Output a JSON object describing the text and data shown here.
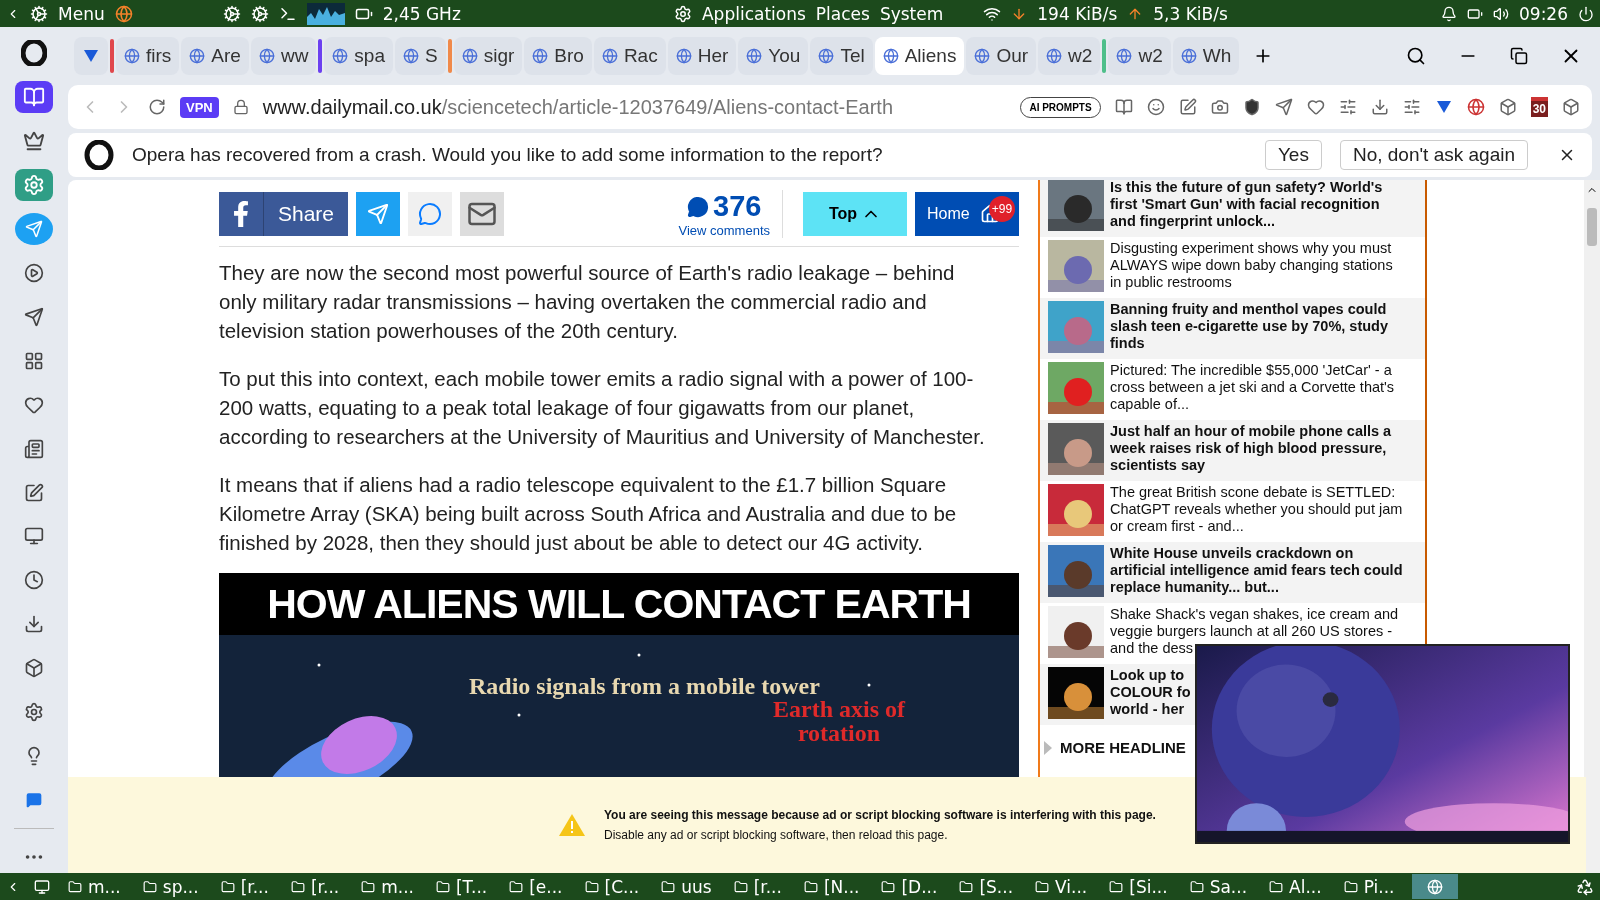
{
  "system_panel": {
    "menu": "Menu",
    "cpu": "2,45 GHz",
    "menus": [
      "Applications",
      "Places",
      "System"
    ],
    "download": "194 KiB/s",
    "upload": "5,3 KiB/s",
    "time": "09:26"
  },
  "tabs": [
    {
      "label": "firs",
      "selected": false,
      "color": "#e0474c"
    },
    {
      "label": "Are",
      "selected": false
    },
    {
      "label": "ww",
      "selected": false
    },
    {
      "label": "spa",
      "selected": false,
      "color": "#6b3ff0"
    },
    {
      "label": "S",
      "selected": false
    },
    {
      "label": "sigr",
      "selected": false,
      "color": "#f0894a"
    },
    {
      "label": "Bro",
      "selected": false
    },
    {
      "label": "Rac",
      "selected": false
    },
    {
      "label": "Her",
      "selected": false
    },
    {
      "label": "You",
      "selected": false
    },
    {
      "label": "Tel",
      "selected": false
    },
    {
      "label": "Aliens",
      "selected": true
    },
    {
      "label": "Our",
      "selected": false
    },
    {
      "label": "w2",
      "selected": false
    },
    {
      "label": "w2",
      "selected": false,
      "color": "#4fbf8a"
    },
    {
      "label": "Wh",
      "selected": false
    }
  ],
  "address_bar": {
    "vpn": "VPN",
    "host": "www.dailymail.co.uk",
    "path": "/sciencetech/article-12037649/Aliens-contact-Earth",
    "ai_prompts": "AI PROMPTS",
    "calendar_day": "30"
  },
  "crash_bar": {
    "message": "Opera has recovered from a crash. Would you like to add some information to the report?",
    "buttons": [
      "Yes",
      "No, don't ask again"
    ]
  },
  "share": {
    "share_label": "Share",
    "comment_count": "376",
    "comments_link": "View comments",
    "top": "Top",
    "home": "Home",
    "home_badge": "+99"
  },
  "paragraphs": [
    "They are now the second most powerful source of Earth's radio leakage – behind only military radar transmissions – having overtaken the commercial radio and television station powerhouses of the 20th century.",
    "To put this into context, each mobile tower emits a radio signal with a power of 100-200 watts, equating to a peak total leakage of four gigawatts from our planet, according to researchers at the University of Mauritius and University of Manchester.",
    "It means that if aliens had a radio telescope equivalent to the £1.7 billion Square Kilometre Array (SKA) being built across South Africa and Australia and due to be finished by 2028, then they should just about be able to detect our 4G activity."
  ],
  "infographic": {
    "title": "HOW ALIENS WILL CONTACT EARTH",
    "labels": [
      "Radio signals from a mobile tower",
      "Earth axis of rotation"
    ]
  },
  "headlines": [
    {
      "lines": [
        "Is this the future of gun safety? World's",
        "first 'Smart Gun' with facial recognition",
        "and fingerprint unlock..."
      ],
      "bold": true
    },
    {
      "lines": [
        "Disgusting experiment shows why you must",
        "ALWAYS wipe down baby changing stations",
        "in public restrooms"
      ],
      "bold": false
    },
    {
      "lines": [
        "Banning fruity and menthol vapes could",
        "slash teen e-cigarette use by 70%, study",
        "finds"
      ],
      "bold": true
    },
    {
      "lines": [
        "Pictured: The incredible $55,000 'JetCar' - a",
        "cross between a jet ski and a Corvette that's",
        "capable of..."
      ],
      "bold": false
    },
    {
      "lines": [
        "Just half an hour of mobile phone calls a",
        "week raises risk of high blood pressure,",
        "scientists say"
      ],
      "bold": true
    },
    {
      "lines": [
        "The great British scone debate is SETTLED:",
        "ChatGPT reveals whether you should put jam",
        "or cream first - and..."
      ],
      "bold": false
    },
    {
      "lines": [
        "White House unveils crackdown on",
        "artificial intelligence amid fears tech could",
        "replace humanity... but..."
      ],
      "bold": true
    },
    {
      "lines": [
        "Shake Shack's vegan shakes, ice cream and",
        "veggie burgers launch at all 260 US stores -",
        "and the dess"
      ],
      "bold": false
    },
    {
      "lines": [
        "Look up to",
        "COLOUR fo",
        "world - her"
      ],
      "bold": true
    }
  ],
  "more_headlines": "MORE HEADLINE",
  "adblock_notice": {
    "title": "You are seeing this message because ad or script blocking software is interfering with this page.",
    "detail": "Disable any ad or script blocking software, then reload this page."
  },
  "taskbar": [
    {
      "label": "m...",
      "selected": false
    },
    {
      "label": "sp...",
      "selected": false
    },
    {
      "label": "[r...",
      "selected": false
    },
    {
      "label": "[r...",
      "selected": false
    },
    {
      "label": "m...",
      "selected": false
    },
    {
      "label": "[T...",
      "selected": false
    },
    {
      "label": "[e...",
      "selected": false
    },
    {
      "label": "[C...",
      "selected": false
    },
    {
      "label": "uus",
      "selected": false
    },
    {
      "label": "[r...",
      "selected": false
    },
    {
      "label": "[N...",
      "selected": false
    },
    {
      "label": "[D...",
      "selected": false
    },
    {
      "label": "[S...",
      "selected": false
    },
    {
      "label": "Vi...",
      "selected": false
    },
    {
      "label": "[Si...",
      "selected": false
    },
    {
      "label": "Sa...",
      "selected": false
    },
    {
      "label": "Al...",
      "selected": false
    },
    {
      "label": "Pi...",
      "selected": false
    },
    {
      "selected": true
    }
  ]
}
